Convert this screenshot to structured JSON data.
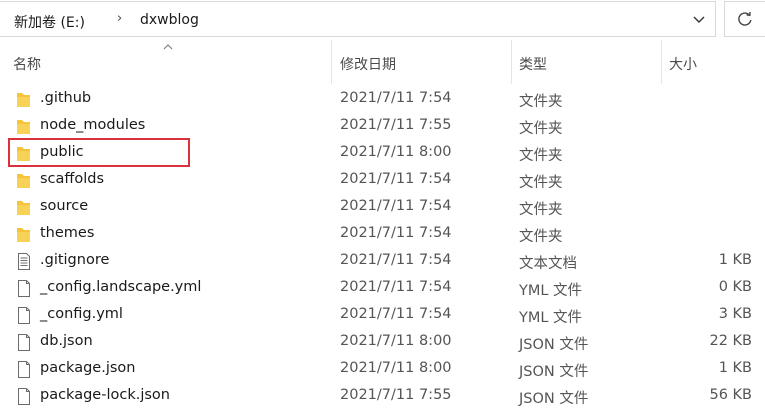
{
  "breadcrumb": {
    "drive": "新加卷 (E:)",
    "folder": "dxwblog"
  },
  "columns": {
    "name": "名称",
    "modified": "修改日期",
    "type": "类型",
    "size": "大小"
  },
  "files": [
    {
      "name": ".github",
      "date": "2021/7/11 7:54",
      "type": "文件夹",
      "size": "",
      "icon": "folder-icon"
    },
    {
      "name": "node_modules",
      "date": "2021/7/11 7:55",
      "type": "文件夹",
      "size": "",
      "icon": "folder-icon"
    },
    {
      "name": "public",
      "date": "2021/7/11 8:00",
      "type": "文件夹",
      "size": "",
      "icon": "folder-icon"
    },
    {
      "name": "scaffolds",
      "date": "2021/7/11 7:54",
      "type": "文件夹",
      "size": "",
      "icon": "folder-icon"
    },
    {
      "name": "source",
      "date": "2021/7/11 7:54",
      "type": "文件夹",
      "size": "",
      "icon": "folder-icon"
    },
    {
      "name": "themes",
      "date": "2021/7/11 7:54",
      "type": "文件夹",
      "size": "",
      "icon": "folder-icon"
    },
    {
      "name": ".gitignore",
      "date": "2021/7/11 7:54",
      "type": "文本文档",
      "size": "1 KB",
      "icon": "text-file-icon"
    },
    {
      "name": "_config.landscape.yml",
      "date": "2021/7/11 7:54",
      "type": "YML 文件",
      "size": "0 KB",
      "icon": "file-icon"
    },
    {
      "name": "_config.yml",
      "date": "2021/7/11 7:54",
      "type": "YML 文件",
      "size": "3 KB",
      "icon": "file-icon"
    },
    {
      "name": "db.json",
      "date": "2021/7/11 8:00",
      "type": "JSON 文件",
      "size": "22 KB",
      "icon": "file-icon"
    },
    {
      "name": "package.json",
      "date": "2021/7/11 8:00",
      "type": "JSON 文件",
      "size": "1 KB",
      "icon": "file-icon"
    },
    {
      "name": "package-lock.json",
      "date": "2021/7/11 7:55",
      "type": "JSON 文件",
      "size": "56 KB",
      "icon": "file-icon"
    }
  ],
  "colors": {
    "highlight": "#d9323c",
    "folder": "#f5c43b"
  }
}
